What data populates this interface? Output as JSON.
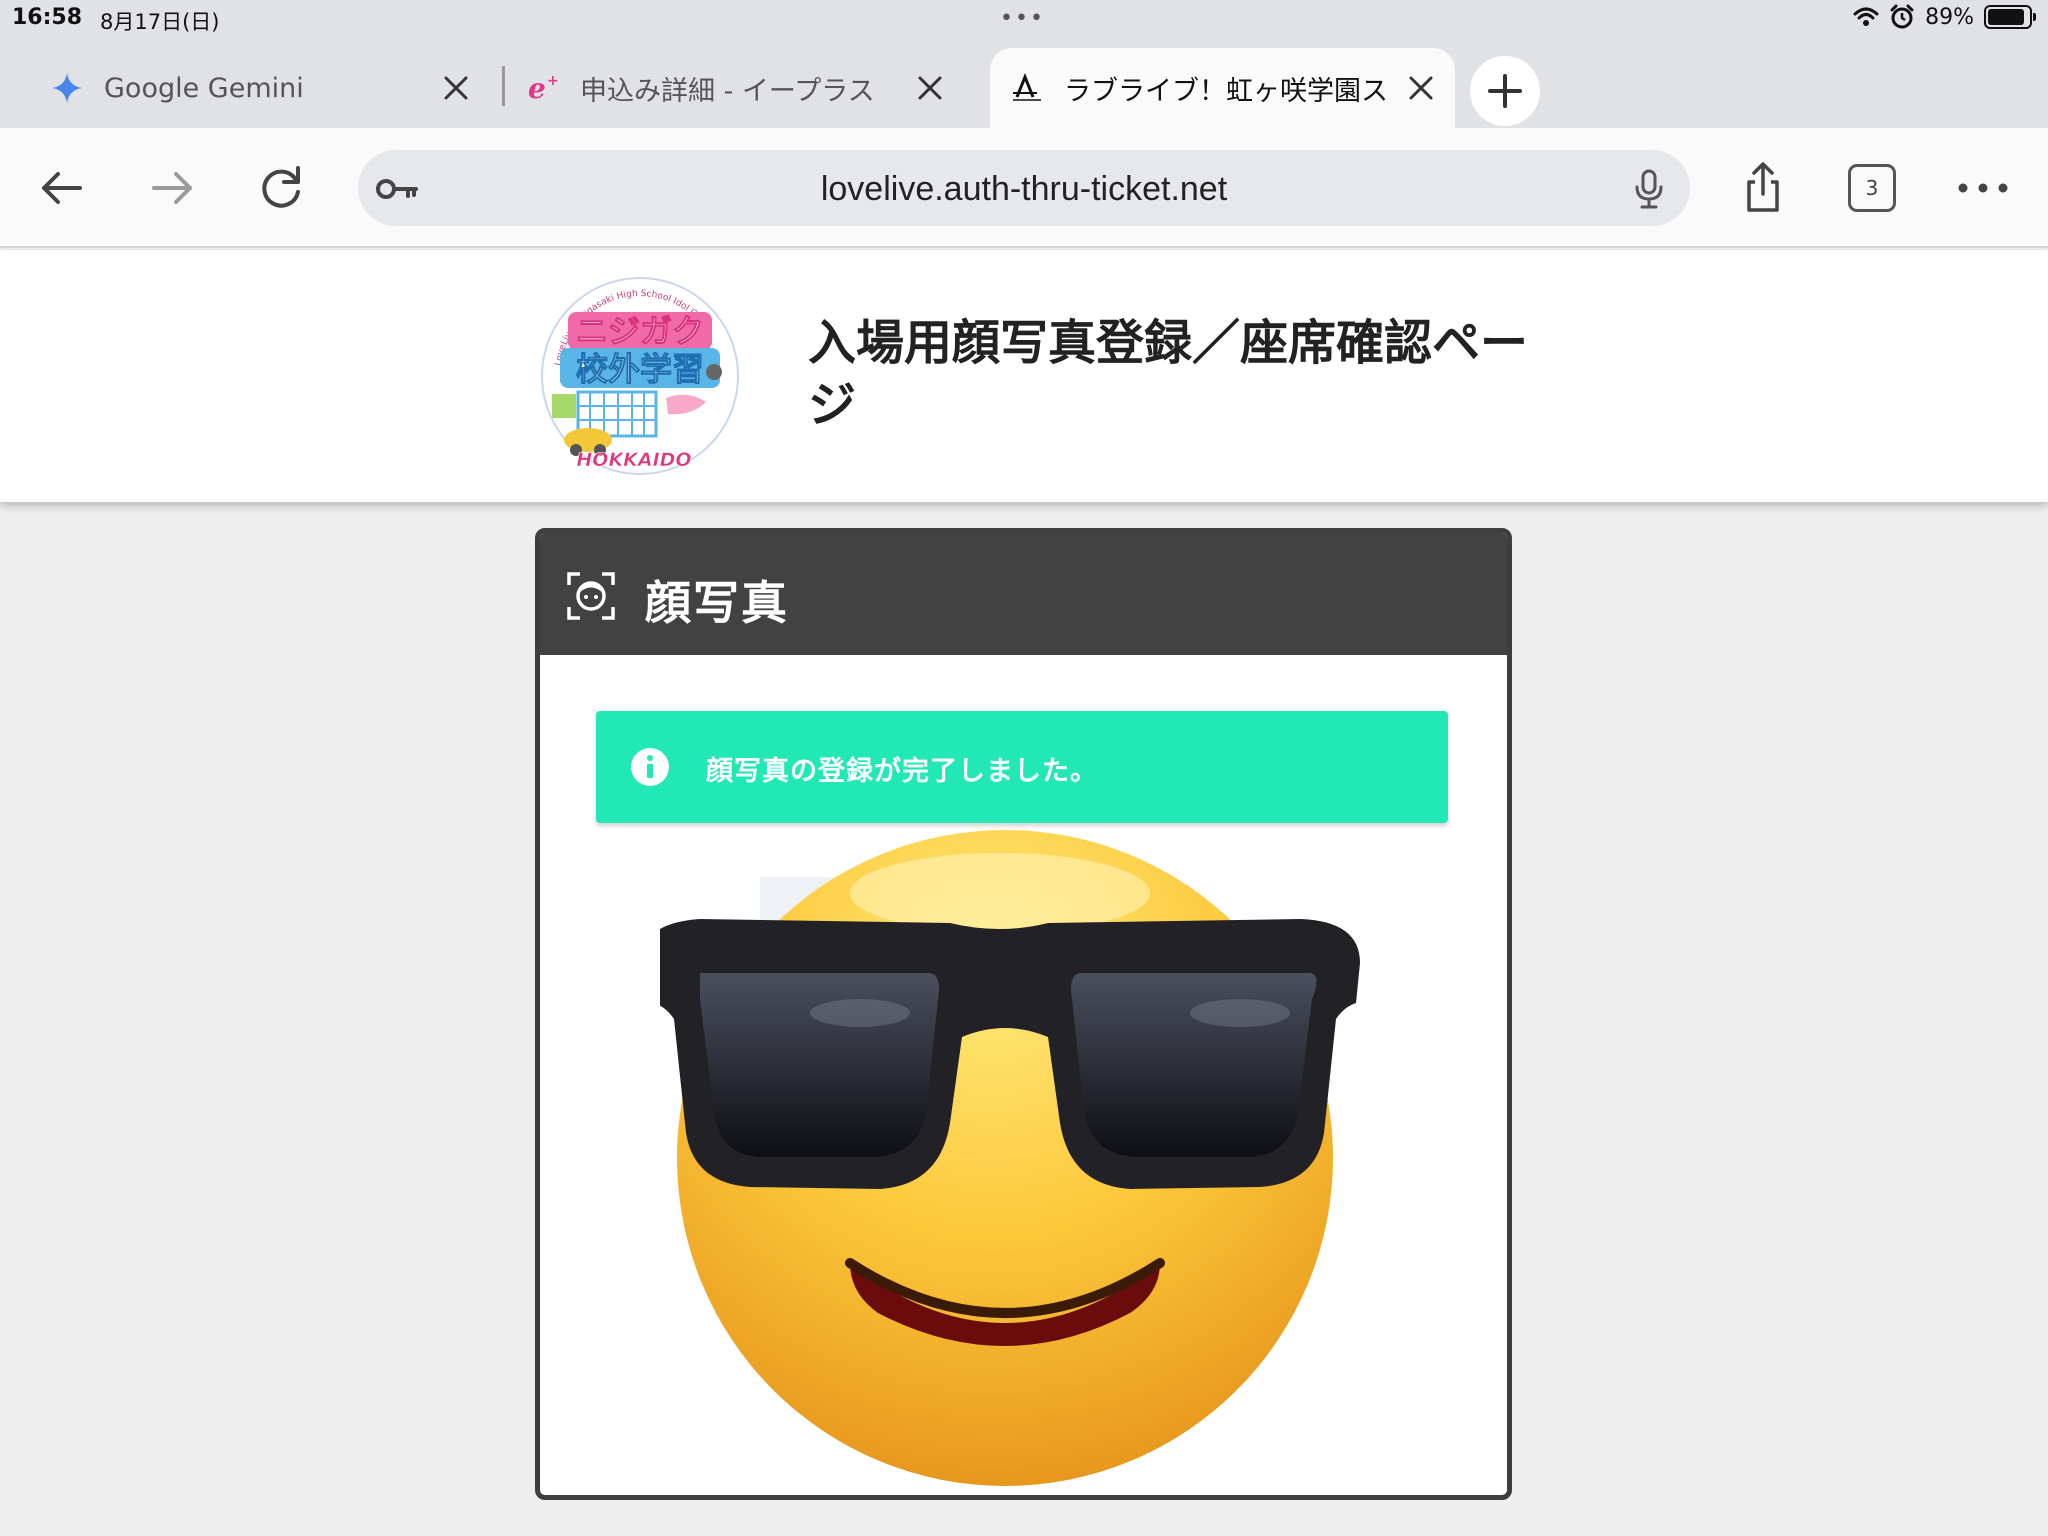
{
  "status_bar": {
    "time": "16:58",
    "date": "8月17日(日)",
    "battery": "89%",
    "battery_level": 0.89,
    "icons": [
      "wifi-icon",
      "alarm-icon",
      "battery-icon"
    ]
  },
  "browser": {
    "tabs": [
      {
        "title": "Google Gemini",
        "favicon": "gemini-icon",
        "active": false
      },
      {
        "title": "申込み詳細 - イープラス",
        "favicon": "eplus-icon",
        "active": false
      },
      {
        "title": "ラブライブ！虹ヶ咲学園ス",
        "favicon": "auth-thru-icon",
        "active": true
      }
    ],
    "url": "lovelive.auth-thru-ticket.net",
    "tab_count": "3",
    "accent": "#22e8b6"
  },
  "page": {
    "heading": "入場用顔写真登録／座席確認ページ",
    "logo": {
      "main_text": [
        "ニジガク",
        "校外学習"
      ],
      "sub_text": "HOKKAIDO",
      "ring_text": "LoveLive! Nijigasaki High School Idol Club"
    },
    "card": {
      "title": "顔写真",
      "notice": "顔写真の登録が完了しました。",
      "photo": "smiling-face-with-sunglasses"
    }
  }
}
